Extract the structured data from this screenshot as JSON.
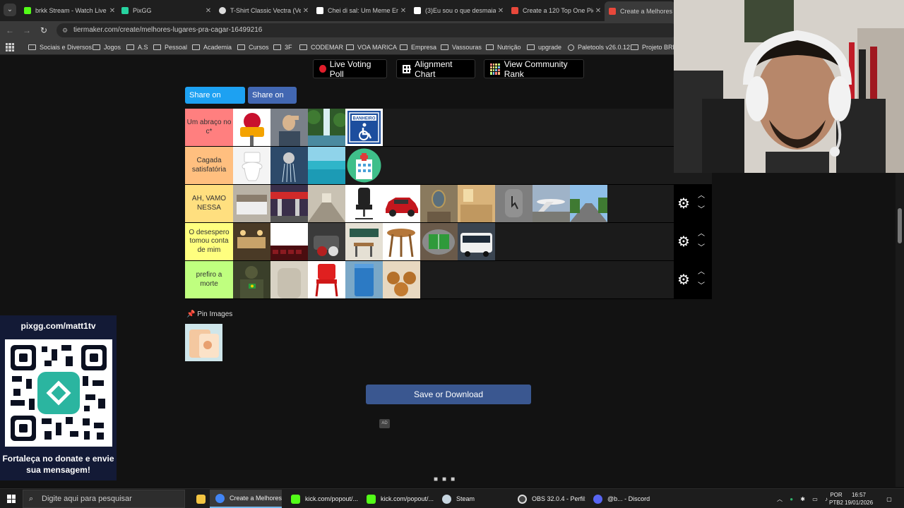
{
  "browser": {
    "tabs": [
      {
        "title": "brkk Stream - Watch Live",
        "color": "#53fc18"
      },
      {
        "title": "PixGG",
        "color": "#27d3a0"
      },
      {
        "title": "T-Shirt Classic Vectra (Vec",
        "color": "#dddddd"
      },
      {
        "title": "Chei di sal: Um Meme Eng",
        "color": "#ffffff"
      },
      {
        "title": "(3)Eu sou o que desmaia",
        "color": "#ffffff"
      },
      {
        "title": "Create a 120 Top One Pie",
        "color": "#e8483b"
      },
      {
        "title": "Create a Melhores lu",
        "color": "#e8483b"
      }
    ],
    "url": "tiermaker.com/create/melhores-lugares-pra-cagar-16499216",
    "bookmarks": [
      "Sociais e Diversos",
      "Jogos",
      "A.S",
      "Pessoal",
      "Academia",
      "Cursos",
      "3F",
      "CODEMAR",
      "VOA MARICA",
      "Empresa",
      "Vassouras",
      "Nutrição",
      "upgrade",
      "Paletools v26.0.12",
      "Projeto BRKK"
    ]
  },
  "page": {
    "live_voting": "Live Voting Poll",
    "alignment": "Alignment Chart",
    "community_rank": "View Community Rank",
    "share_twitter": "Share on Twitter",
    "share_fb": "Share on FB",
    "pin_images": "Pin Images",
    "save": "Save or Download",
    "ad": "AD",
    "tiers": [
      {
        "label": "Um abraço no c*",
        "color": "#ff7f7f"
      },
      {
        "label": "Cagada satisfatória",
        "color": "#ffbf7f"
      },
      {
        "label": "AH, VAMO NESSA",
        "color": "#ffdf7f"
      },
      {
        "label": "O desespero tomou conta de mim",
        "color": "#ffff7f"
      },
      {
        "label": "prefiro a morte",
        "color": "#bfff7f"
      }
    ]
  },
  "overlay": {
    "pix_url": "pixgg.com/matt1tv",
    "pix_message": "Fortaleça no donate e envie sua mensagem!"
  },
  "taskbar": {
    "search": "Digite aqui para pesquisar",
    "apps": [
      {
        "title": "Create a Melhores l...",
        "color": "#4285f4"
      },
      {
        "title": "kick.com/popout/...",
        "color": "#53fc18"
      },
      {
        "title": "kick.com/popout/...",
        "color": "#53fc18"
      },
      {
        "title": "Steam",
        "color": "#1b2838"
      },
      {
        "title": "OBS 32.0.4 - Perfil: ...",
        "color": "#302e31"
      },
      {
        "title": "@b... - Discord",
        "color": "#5865f2"
      }
    ],
    "lang_top": "POR",
    "lang_bottom": "PTB2",
    "time": "16:57",
    "date": "19/01/2026"
  }
}
